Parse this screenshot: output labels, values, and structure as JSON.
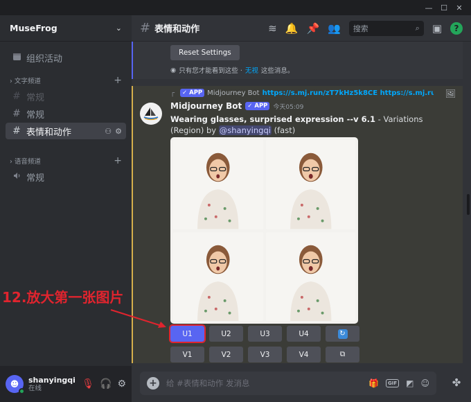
{
  "window": {
    "minimize": "—",
    "maximize": "☐",
    "close": "✕"
  },
  "server": {
    "name": "MuseFrog"
  },
  "sidebar": {
    "top_item": "组织活动",
    "text_category": "文字频道",
    "text_channels": [
      {
        "label": "常规",
        "muted": true
      },
      {
        "label": "常规",
        "muted": false
      },
      {
        "label": "表情和动作",
        "active": true
      }
    ],
    "voice_category": "语音频道",
    "voice_channels": [
      {
        "label": "常规"
      }
    ]
  },
  "user": {
    "name": "shanyingqi",
    "status": "在线"
  },
  "topbar": {
    "channel": "表情和动作",
    "search_placeholder": "搜索"
  },
  "ephemeral": {
    "button": "Reset Settings",
    "note_prefix": "只有您才能看到这些 · ",
    "note_link": "无视",
    "note_suffix": " 这些消息。"
  },
  "reply": {
    "tag": "APP",
    "author": "Midjourney Bot",
    "link": "https://s.mj.run/zT7kHz5k8CE https://s.mj.run/..."
  },
  "message": {
    "author": "Midjourney Bot",
    "tag": "APP",
    "time": "今天05:09",
    "prompt": "Wearing glasses, surprised expression --v 6.1",
    "suffix": " - Variations (Region) by",
    "mention": "@shanyingqi",
    "speed": " (fast)"
  },
  "buttons": {
    "row1": [
      "U1",
      "U2",
      "U3",
      "U4"
    ],
    "row2": [
      "V1",
      "V2",
      "V3",
      "V4"
    ],
    "refresh_icon": "refresh-icon",
    "open_icon": "open-external-icon"
  },
  "composer": {
    "placeholder": "给 #表情和动作 发消息"
  },
  "annotation": {
    "text": "12.放大第一张图片",
    "color": "#e0242e"
  },
  "colors": {
    "accent": "#5865f2",
    "highlight_bar": "#d6b04c",
    "online": "#23a55a"
  }
}
